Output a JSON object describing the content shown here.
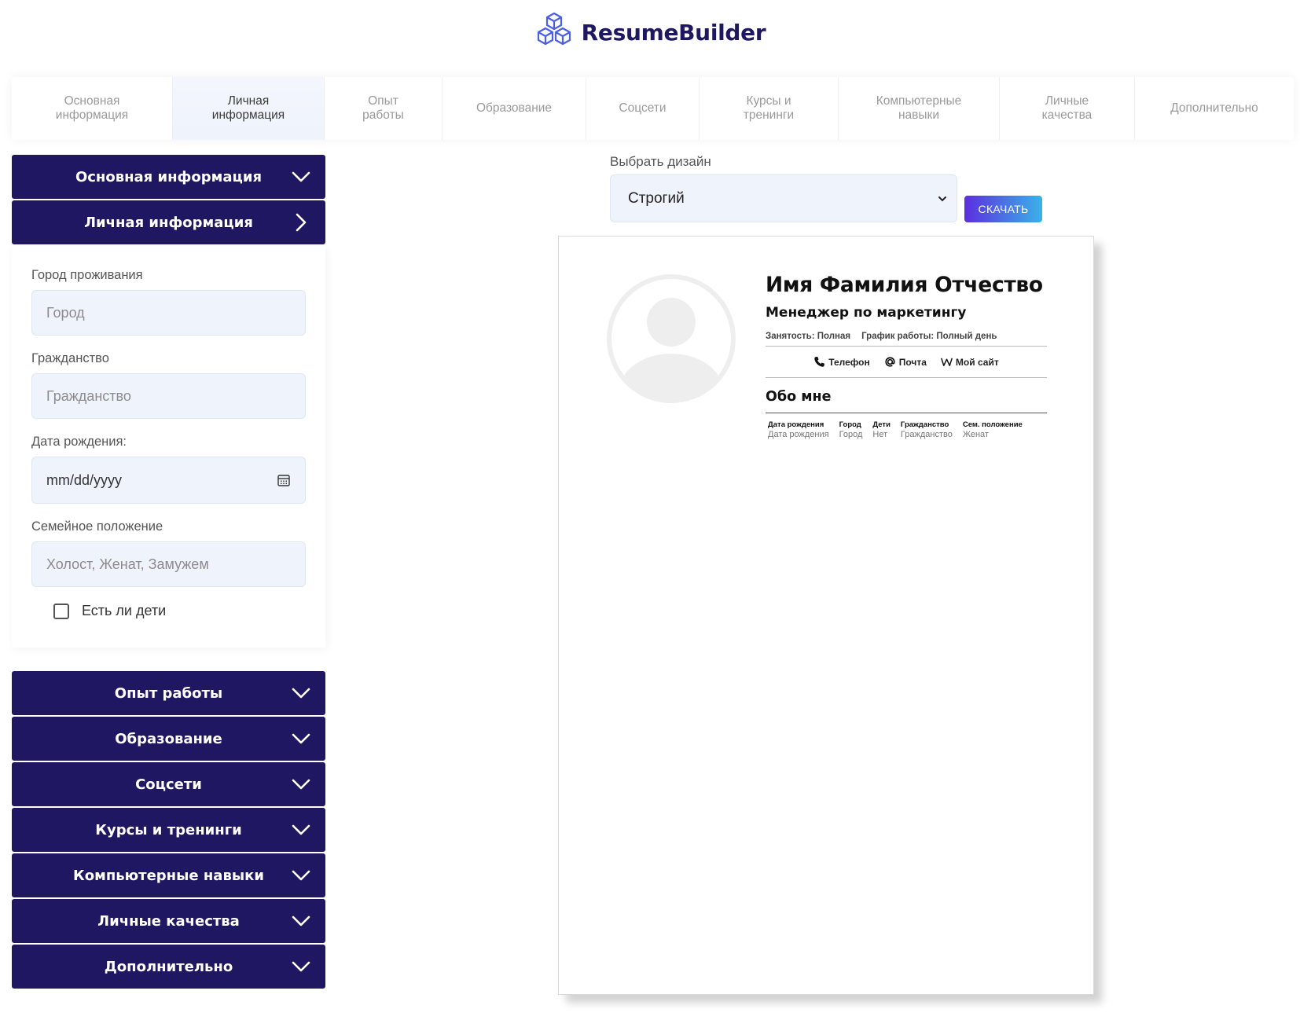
{
  "app": {
    "name": "ResumeBuilder"
  },
  "tabs": [
    {
      "label": "Основная\nинформация",
      "active": false
    },
    {
      "label": "Личная\nинформация",
      "active": true
    },
    {
      "label": "Опыт\nработы",
      "active": false
    },
    {
      "label": "Образование",
      "active": false
    },
    {
      "label": "Соцсети",
      "active": false
    },
    {
      "label": "Курсы и\nтренинги",
      "active": false
    },
    {
      "label": "Компьютерные\nнавыки",
      "active": false
    },
    {
      "label": "Личные\nкачества",
      "active": false
    },
    {
      "label": "Дополнительно",
      "active": false
    }
  ],
  "sidebar": {
    "basic_info": "Основная информация",
    "personal_info": "Личная информация",
    "form": {
      "city_label": "Город проживания",
      "city_placeholder": "Город",
      "citizenship_label": "Гражданство",
      "citizenship_placeholder": "Гражданство",
      "birthdate_label": "Дата рождения:",
      "birthdate_placeholder": "mm/dd/yyyy",
      "marital_label": "Семейное положение",
      "marital_placeholder": "Холост, Женат, Замужем",
      "children_label": "Есть ли дети",
      "children_checked": false
    },
    "sections": [
      "Опыт работы",
      "Образование",
      "Соцсети",
      "Курсы и тренинги",
      "Компьютерные навыки",
      "Личные качества",
      "Дополнительно"
    ]
  },
  "design": {
    "label": "Выбрать дизайн",
    "selected": "Строгий",
    "download_label": "СКАЧАТЬ"
  },
  "resume": {
    "name": "Имя Фамилия Отчество",
    "position": "Менеджер по маркетингу",
    "employment": "Занятость: Полная",
    "schedule": "График работы: Полный день",
    "contacts": {
      "phone": "Телефон",
      "email": "Почта",
      "site": "Мой сайт"
    },
    "about_title": "Обо мне",
    "table": [
      {
        "head": "Дата рождения",
        "value": "Дата рождения"
      },
      {
        "head": "Город",
        "value": "Город"
      },
      {
        "head": "Дети",
        "value": "Нет"
      },
      {
        "head": "Гражданство",
        "value": "Гражданство"
      },
      {
        "head": "Сем. положение",
        "value": "Женат"
      }
    ]
  },
  "colors": {
    "brand": "#1e1860",
    "accordion": "#1f1762",
    "input_bg": "#eef3fc",
    "button_gradient_start": "#5b2ee0",
    "button_gradient_end": "#3ab2e8"
  }
}
